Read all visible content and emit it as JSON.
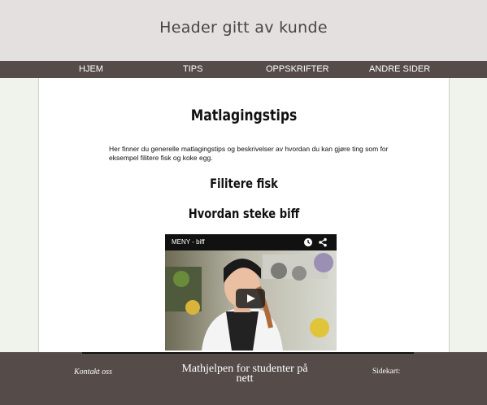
{
  "header": {
    "title": "Header gitt av kunde"
  },
  "nav": {
    "items": [
      {
        "label": "HJEM"
      },
      {
        "label": "TIPS"
      },
      {
        "label": "OPPSKRIFTER"
      },
      {
        "label": "ANDRE SIDER"
      }
    ]
  },
  "main": {
    "title": "Matlagingstips",
    "intro": "Her finner du generelle matlagingstips og beskrivelser av hvordan du kan gjøre ting som for eksempel filitere fisk og koke egg.",
    "sections": [
      {
        "label": "Filitere fisk"
      },
      {
        "label": "Hvordan steke biff"
      }
    ],
    "video": {
      "title": "MENY - biff",
      "icons": [
        "clock-icon",
        "share-icon",
        "play-icon"
      ]
    }
  },
  "footer": {
    "contact": "Kontakt oss",
    "title": "Mathjelpen for studenter på nett",
    "sitemap": "Sidekart:"
  },
  "colors": {
    "header_bg": "#e4e0df",
    "nav_bg": "#554c4a",
    "footer_bg": "#554c4a",
    "side_bg": "#f0f2ec",
    "video_play": "#cc0000"
  }
}
